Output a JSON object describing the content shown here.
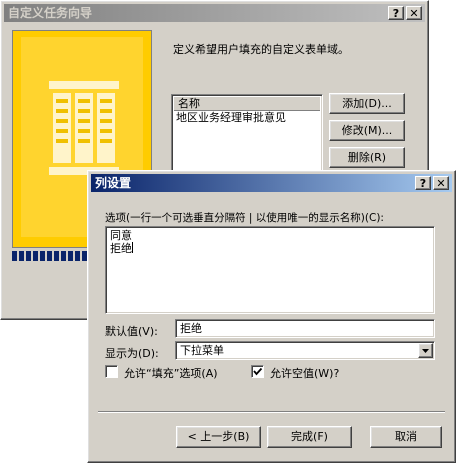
{
  "wizard": {
    "title": "自定义任务向导",
    "help_btn": "?",
    "close_btn": "✕",
    "instruction": "定义希望用户填充的自定义表单域。",
    "list_header": "名称",
    "list_items": [
      "地区业务经理审批意见"
    ],
    "add_btn": "添加(D)...",
    "modify_btn": "修改(M)...",
    "delete_btn": "删除(R)"
  },
  "dialog": {
    "title": "列设置",
    "help_btn": "?",
    "close_btn": "✕",
    "options_label": "选项(一行一个可选垂直分隔符 | 以使用唯一的显示名称)(C):",
    "options_lines": [
      "同意",
      "拒绝"
    ],
    "default_label": "默认值(V):",
    "default_value": "拒绝",
    "display_label": "显示为(D):",
    "display_value": "下拉菜单",
    "allow_fill_label": "允许“填充”选项(A)",
    "allow_fill_checked": false,
    "allow_empty_label": "允许空值(W)?",
    "allow_empty_checked": true,
    "back_btn": "< 上一步(B)",
    "finish_btn": "完成(F)",
    "cancel_btn": "取消"
  },
  "colors": {
    "active_title": "#0a246a",
    "inactive_title": "#808080",
    "wizard_art": "#ffcc00",
    "progress": "#0a246a"
  }
}
